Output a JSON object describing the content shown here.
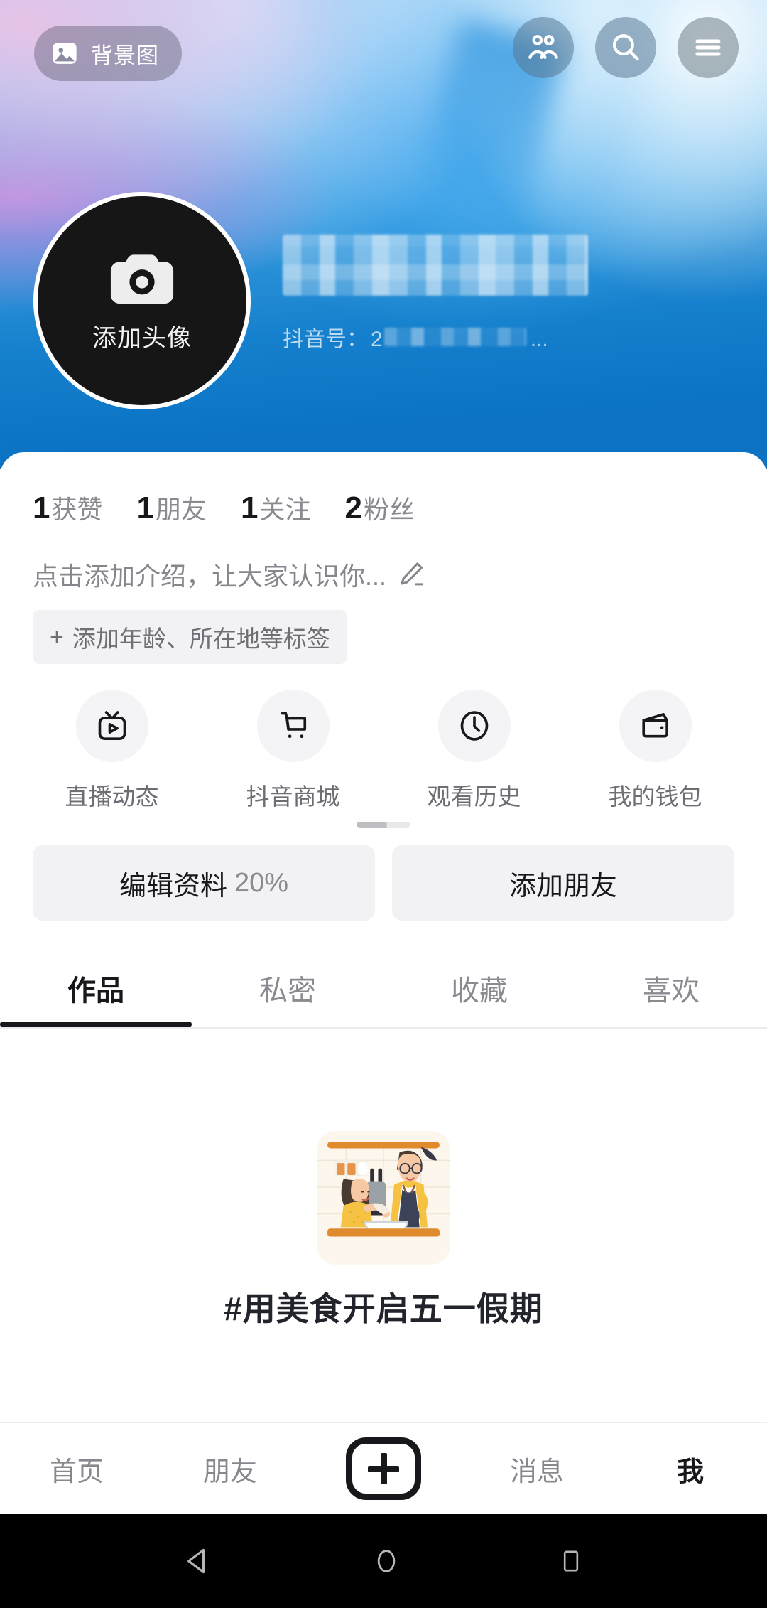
{
  "hero": {
    "cover_button": {
      "label": "背景图",
      "icon": "image-icon"
    },
    "header_buttons": [
      {
        "name": "contacts-icon",
        "label": "通讯录"
      },
      {
        "name": "search-icon",
        "label": "搜索"
      },
      {
        "name": "menu-icon",
        "label": "菜单"
      }
    ],
    "avatar": {
      "add_label": "添加头像",
      "icon": "camera-icon"
    },
    "username_masked": "",
    "douyin_id_label": "抖音号：",
    "douyin_id_prefix": "2",
    "douyin_id_tail": "...",
    "colors": {
      "cover_bottom": "#0b72c4",
      "accent_purple": "#b98cdf"
    }
  },
  "stats": [
    {
      "num": "1",
      "label": "获赞"
    },
    {
      "num": "1",
      "label": "朋友"
    },
    {
      "num": "1",
      "label": "关注"
    },
    {
      "num": "2",
      "label": "粉丝"
    }
  ],
  "bio": {
    "placeholder": "点击添加介绍，让大家认识你...",
    "edit_icon": "pencil-icon"
  },
  "tag_chip": {
    "plus": "+",
    "label": "添加年龄、所在地等标签"
  },
  "quick_actions": [
    {
      "icon": "live-tv-icon",
      "label": "直播动态"
    },
    {
      "icon": "shopping-cart-icon",
      "label": "抖音商城"
    },
    {
      "icon": "clock-icon",
      "label": "观看历史"
    },
    {
      "icon": "wallet-icon",
      "label": "我的钱包"
    }
  ],
  "action_buttons": {
    "edit_profile": {
      "label": "编辑资料",
      "percent": "20%"
    },
    "add_friend": {
      "label": "添加朋友"
    }
  },
  "tabs": [
    {
      "label": "作品",
      "active": true
    },
    {
      "label": "私密",
      "active": false
    },
    {
      "label": "收藏",
      "active": false
    },
    {
      "label": "喜欢",
      "active": false
    }
  ],
  "empty_state": {
    "illustration": "cooking-couple-illustration",
    "title": "#用美食开启五一假期"
  },
  "bottom_nav": [
    {
      "label": "首页",
      "active": false
    },
    {
      "label": "朋友",
      "active": false
    },
    {
      "label": "",
      "active": false,
      "icon": "plus-icon"
    },
    {
      "label": "消息",
      "active": false
    },
    {
      "label": "我",
      "active": true
    }
  ],
  "system_bar": [
    {
      "icon": "back-icon"
    },
    {
      "icon": "home-icon"
    },
    {
      "icon": "recents-icon"
    }
  ]
}
